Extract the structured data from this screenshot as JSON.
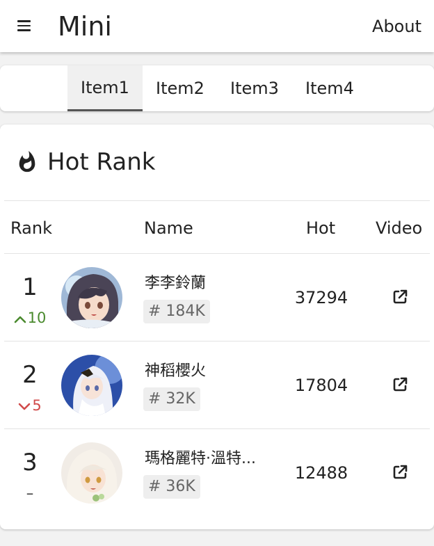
{
  "app": {
    "title": "Mini",
    "about_label": "About"
  },
  "tabs": [
    {
      "label": "Item1"
    },
    {
      "label": "Item2"
    },
    {
      "label": "Item3"
    },
    {
      "label": "Item4"
    }
  ],
  "ranking": {
    "title": "Hot Rank",
    "columns": {
      "rank": "Rank",
      "name": "Name",
      "hot": "Hot",
      "video": "Video"
    },
    "rows": [
      {
        "rank": "1",
        "change": "10",
        "change_dir": "up",
        "name": "李李鈴蘭",
        "tag": "# 184K",
        "hot": "37294"
      },
      {
        "rank": "2",
        "change": "5",
        "change_dir": "down",
        "name": "神稻櫻火",
        "tag": "# 32K",
        "hot": "17804"
      },
      {
        "rank": "3",
        "change": "–",
        "change_dir": "none",
        "name": "瑪格麗特·溫特...",
        "tag": "# 36K",
        "hot": "12488"
      }
    ]
  },
  "colors": {
    "up": "#4a8a2e",
    "down": "#d14a4a",
    "active_tab_bg": "#f0f0f0"
  }
}
